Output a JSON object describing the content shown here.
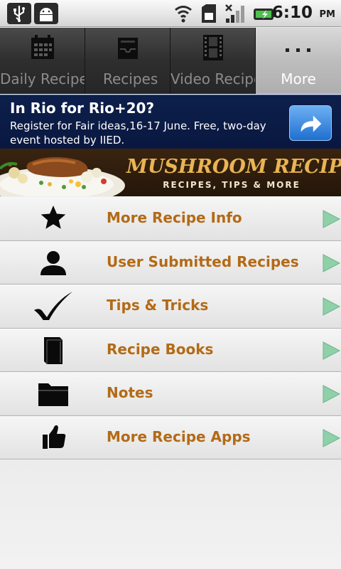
{
  "status_bar": {
    "time": "6:10",
    "ampm": "PM",
    "icons": [
      "usb-icon",
      "android-debug-icon",
      "wifi-icon",
      "sim-icon",
      "signal-icon",
      "battery-icon"
    ]
  },
  "tabs": [
    {
      "label": "Daily Recipes",
      "icon": "calendar-icon",
      "active": false
    },
    {
      "label": "Recipes",
      "icon": "inbox-icon",
      "active": false
    },
    {
      "label": "Video Recipe",
      "icon": "film-icon",
      "active": false
    },
    {
      "label": "More",
      "icon": "more-dots-icon",
      "active": true
    }
  ],
  "ad": {
    "title": "In Rio for Rio+20?",
    "text": "Register for Fair ideas,16-17 June. Free, two-day event hosted by IIED.",
    "button_icon": "share-arrow-icon",
    "colors": {
      "background": "#0c1f4b",
      "button": "#2f80db"
    }
  },
  "banner": {
    "title": "MUSHROOM RECIPES",
    "subtitle": "RECIPES, TIPS & MORE",
    "title_color": "#e9b453"
  },
  "menu": {
    "label_color": "#b36a16",
    "arrow_color": "#8fd0a8",
    "items": [
      {
        "label": "More Recipe Info",
        "icon": "star-icon"
      },
      {
        "label": "User Submitted Recipes",
        "icon": "user-icon"
      },
      {
        "label": "Tips & Tricks",
        "icon": "checkmark-icon"
      },
      {
        "label": "Recipe Books",
        "icon": "book-icon"
      },
      {
        "label": "Notes",
        "icon": "folder-icon"
      },
      {
        "label": "More Recipe Apps",
        "icon": "thumbs-up-icon"
      }
    ]
  }
}
